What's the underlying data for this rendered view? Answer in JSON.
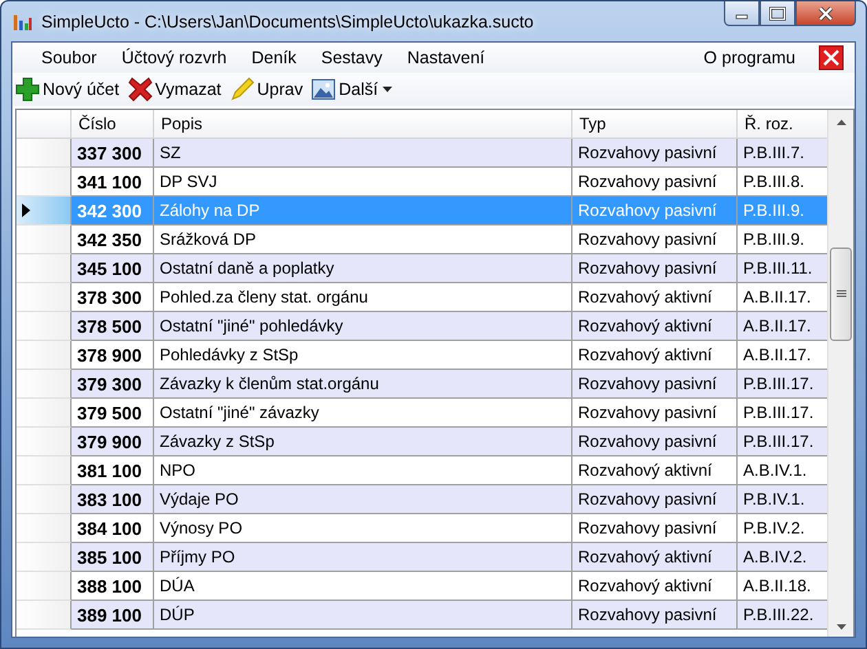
{
  "window": {
    "title": "SimpleUcto - C:\\Users\\Jan\\Documents\\SimpleUcto\\ukazka.sucto"
  },
  "menu": [
    {
      "label": "Soubor"
    },
    {
      "label": "Účtový rozvrh"
    },
    {
      "label": "Deník"
    },
    {
      "label": "Sestavy"
    },
    {
      "label": "Nastavení"
    }
  ],
  "menu_right": {
    "label": "O programu"
  },
  "toolbar": [
    {
      "label": "Nový účet",
      "kind": "add"
    },
    {
      "label": "Vymazat",
      "kind": "delete"
    },
    {
      "label": "Uprav",
      "kind": "edit"
    },
    {
      "label": "Další",
      "kind": "more"
    }
  ],
  "table": {
    "columns": [
      "Číslo",
      "Popis",
      "Typ",
      "Ř. roz."
    ],
    "rows": [
      {
        "cells": [
          "337 300",
          "SZ",
          "Rozvahovy pasivní",
          "P.B.III.7."
        ],
        "selected": false
      },
      {
        "cells": [
          "341 100",
          "DP SVJ",
          "Rozvahovy pasivní",
          "P.B.III.8."
        ],
        "selected": false
      },
      {
        "cells": [
          "342 300",
          "Zálohy na DP",
          "Rozvahovy pasivní",
          "P.B.III.9."
        ],
        "selected": true
      },
      {
        "cells": [
          "342 350",
          "Srážková DP",
          "Rozvahovy pasivní",
          "P.B.III.9."
        ],
        "selected": false
      },
      {
        "cells": [
          "345 100",
          "Ostatní daně a poplatky",
          "Rozvahovy pasivní",
          "P.B.III.11."
        ],
        "selected": false
      },
      {
        "cells": [
          "378 300",
          "Pohled.za členy stat. orgánu",
          "Rozvahový aktivní",
          "A.B.II.17."
        ],
        "selected": false
      },
      {
        "cells": [
          "378 500",
          "Ostatní \"jiné\" pohledávky",
          "Rozvahový aktivní",
          "A.B.II.17."
        ],
        "selected": false
      },
      {
        "cells": [
          "378 900",
          "Pohledávky z StSp",
          "Rozvahový aktivní",
          "A.B.II.17."
        ],
        "selected": false
      },
      {
        "cells": [
          "379 300",
          "Závazky k členům stat.orgánu",
          "Rozvahovy pasivní",
          "P.B.III.17."
        ],
        "selected": false
      },
      {
        "cells": [
          "379 500",
          "Ostatní \"jiné\" závazky",
          "Rozvahovy pasivní",
          "P.B.III.17."
        ],
        "selected": false
      },
      {
        "cells": [
          "379 900",
          "Závazky z StSp",
          "Rozvahovy pasivní",
          "P.B.III.17."
        ],
        "selected": false
      },
      {
        "cells": [
          "381 100",
          "NPO",
          "Rozvahový aktivní",
          "A.B.IV.1."
        ],
        "selected": false
      },
      {
        "cells": [
          "383 100",
          "Výdaje PO",
          "Rozvahovy pasivní",
          "P.B.IV.1."
        ],
        "selected": false
      },
      {
        "cells": [
          "384 100",
          "Výnosy PO",
          "Rozvahovy pasivní",
          "P.B.IV.2."
        ],
        "selected": false
      },
      {
        "cells": [
          "385 100",
          "Příjmy PO",
          "Rozvahový aktivní",
          "A.B.IV.2."
        ],
        "selected": false
      },
      {
        "cells": [
          "388 100",
          "DÚA",
          "Rozvahový aktivní",
          "A.B.II.18."
        ],
        "selected": false
      },
      {
        "cells": [
          "389 100",
          "DÚP",
          "Rozvahovy pasivní",
          "P.B.III.22."
        ],
        "selected": false
      }
    ]
  }
}
